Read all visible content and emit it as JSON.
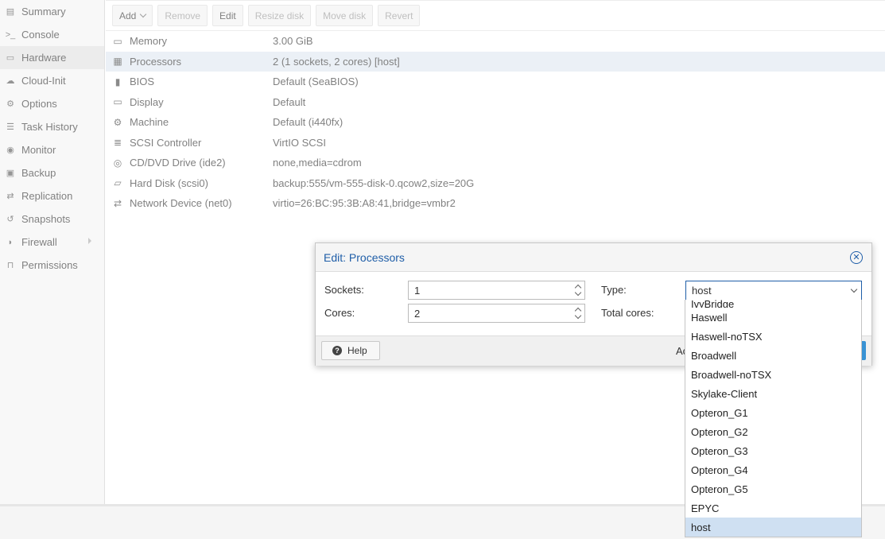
{
  "sidebar": {
    "items": [
      {
        "label": "Summary",
        "icon": "book-icon"
      },
      {
        "label": "Console",
        "icon": "terminal-icon"
      },
      {
        "label": "Hardware",
        "icon": "monitor-icon",
        "active": true
      },
      {
        "label": "Cloud-Init",
        "icon": "cloud-icon"
      },
      {
        "label": "Options",
        "icon": "gear-icon"
      },
      {
        "label": "Task History",
        "icon": "list-icon"
      },
      {
        "label": "Monitor",
        "icon": "eye-icon"
      },
      {
        "label": "Backup",
        "icon": "floppy-icon"
      },
      {
        "label": "Replication",
        "icon": "retweet-icon"
      },
      {
        "label": "Snapshots",
        "icon": "history-icon"
      },
      {
        "label": "Firewall",
        "icon": "shield-icon"
      },
      {
        "label": "Permissions",
        "icon": "unlock-icon"
      }
    ]
  },
  "toolbar": {
    "add": "Add",
    "remove": "Remove",
    "edit": "Edit",
    "resize_disk": "Resize disk",
    "move_disk": "Move disk",
    "revert": "Revert"
  },
  "hardware": [
    {
      "name": "Memory",
      "value": "3.00 GiB",
      "icon": "memory-icon"
    },
    {
      "name": "Processors",
      "value": "2 (1 sockets, 2 cores) [host]",
      "icon": "cpu-icon"
    },
    {
      "name": "BIOS",
      "value": "Default (SeaBIOS)",
      "icon": "chip-icon"
    },
    {
      "name": "Display",
      "value": "Default",
      "icon": "display-icon"
    },
    {
      "name": "Machine",
      "value": "Default (i440fx)",
      "icon": "cogs-icon"
    },
    {
      "name": "SCSI Controller",
      "value": "VirtIO SCSI",
      "icon": "database-icon"
    },
    {
      "name": "CD/DVD Drive (ide2)",
      "value": "none,media=cdrom",
      "icon": "cdrom-icon"
    },
    {
      "name": "Hard Disk (scsi0)",
      "value": "backup:555/vm-555-disk-0.qcow2,size=20G",
      "icon": "harddisk-icon"
    },
    {
      "name": "Network Device (net0)",
      "value": "virtio=26:BC:95:3B:A8:41,bridge=vmbr2",
      "icon": "exchange-icon"
    }
  ],
  "dialog": {
    "title": "Edit: Processors",
    "sockets_label": "Sockets:",
    "sockets_value": "1",
    "cores_label": "Cores:",
    "cores_value": "2",
    "type_label": "Type:",
    "type_value": "host",
    "total_cores_label": "Total cores:",
    "help": "Help",
    "footer_partial": "Ac"
  },
  "type_dropdown": {
    "clipped_item": "IvyBridge",
    "items": [
      "Haswell",
      "Haswell-noTSX",
      "Broadwell",
      "Broadwell-noTSX",
      "Skylake-Client",
      "Opteron_G1",
      "Opteron_G2",
      "Opteron_G3",
      "Opteron_G4",
      "Opteron_G5",
      "EPYC",
      "host"
    ],
    "selected": "host"
  }
}
